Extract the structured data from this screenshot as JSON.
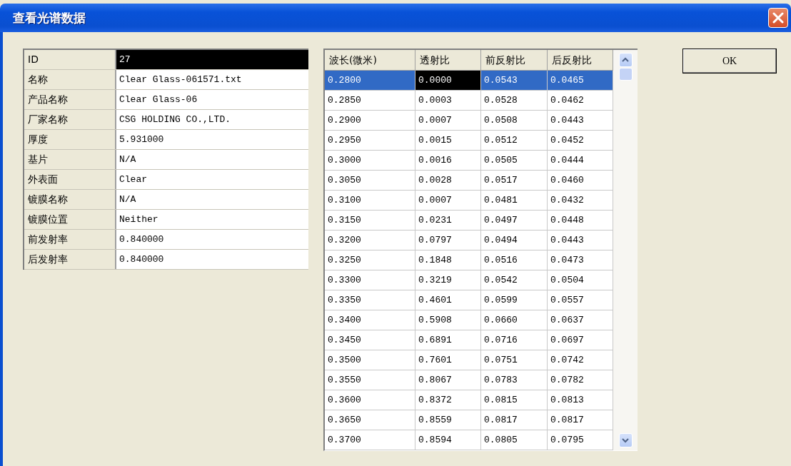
{
  "window": {
    "title": "查看光谱数据"
  },
  "properties": [
    {
      "label": "ID",
      "value": "27",
      "focused": true
    },
    {
      "label": "名称",
      "value": "Clear Glass-061571.txt",
      "focused": false
    },
    {
      "label": "产品名称",
      "value": "Clear Glass-06",
      "focused": false
    },
    {
      "label": "厂家名称",
      "value": "CSG HOLDING CO.,LTD.",
      "focused": false
    },
    {
      "label": "厚度",
      "value": "5.931000",
      "focused": false
    },
    {
      "label": "基片",
      "value": "N/A",
      "focused": false
    },
    {
      "label": "外表面",
      "value": "Clear",
      "focused": false
    },
    {
      "label": "镀膜名称",
      "value": "N/A",
      "focused": false
    },
    {
      "label": "镀膜位置",
      "value": "Neither",
      "focused": false
    },
    {
      "label": "前发射率",
      "value": "0.840000",
      "focused": false
    },
    {
      "label": "后发射率",
      "value": "0.840000",
      "focused": false
    }
  ],
  "table": {
    "columns": [
      "波长(微米)",
      "透射比",
      "前反射比",
      "后反射比"
    ],
    "rows": [
      {
        "selected": true,
        "cells": [
          {
            "text": "0.2800",
            "focused": false
          },
          {
            "text": "0.0000",
            "focused": true
          },
          {
            "text": "0.0543",
            "focused": false
          },
          {
            "text": "0.0465",
            "focused": false
          }
        ]
      },
      {
        "selected": false,
        "cells": [
          {
            "text": "0.2850",
            "focused": false
          },
          {
            "text": "0.0003",
            "focused": false
          },
          {
            "text": "0.0528",
            "focused": false
          },
          {
            "text": "0.0462",
            "focused": false
          }
        ]
      },
      {
        "selected": false,
        "cells": [
          {
            "text": "0.2900",
            "focused": false
          },
          {
            "text": "0.0007",
            "focused": false
          },
          {
            "text": "0.0508",
            "focused": false
          },
          {
            "text": "0.0443",
            "focused": false
          }
        ]
      },
      {
        "selected": false,
        "cells": [
          {
            "text": "0.2950",
            "focused": false
          },
          {
            "text": "0.0015",
            "focused": false
          },
          {
            "text": "0.0512",
            "focused": false
          },
          {
            "text": "0.0452",
            "focused": false
          }
        ]
      },
      {
        "selected": false,
        "cells": [
          {
            "text": "0.3000",
            "focused": false
          },
          {
            "text": "0.0016",
            "focused": false
          },
          {
            "text": "0.0505",
            "focused": false
          },
          {
            "text": "0.0444",
            "focused": false
          }
        ]
      },
      {
        "selected": false,
        "cells": [
          {
            "text": "0.3050",
            "focused": false
          },
          {
            "text": "0.0028",
            "focused": false
          },
          {
            "text": "0.0517",
            "focused": false
          },
          {
            "text": "0.0460",
            "focused": false
          }
        ]
      },
      {
        "selected": false,
        "cells": [
          {
            "text": "0.3100",
            "focused": false
          },
          {
            "text": "0.0007",
            "focused": false
          },
          {
            "text": "0.0481",
            "focused": false
          },
          {
            "text": "0.0432",
            "focused": false
          }
        ]
      },
      {
        "selected": false,
        "cells": [
          {
            "text": "0.3150",
            "focused": false
          },
          {
            "text": "0.0231",
            "focused": false
          },
          {
            "text": "0.0497",
            "focused": false
          },
          {
            "text": "0.0448",
            "focused": false
          }
        ]
      },
      {
        "selected": false,
        "cells": [
          {
            "text": "0.3200",
            "focused": false
          },
          {
            "text": "0.0797",
            "focused": false
          },
          {
            "text": "0.0494",
            "focused": false
          },
          {
            "text": "0.0443",
            "focused": false
          }
        ]
      },
      {
        "selected": false,
        "cells": [
          {
            "text": "0.3250",
            "focused": false
          },
          {
            "text": "0.1848",
            "focused": false
          },
          {
            "text": "0.0516",
            "focused": false
          },
          {
            "text": "0.0473",
            "focused": false
          }
        ]
      },
      {
        "selected": false,
        "cells": [
          {
            "text": "0.3300",
            "focused": false
          },
          {
            "text": "0.3219",
            "focused": false
          },
          {
            "text": "0.0542",
            "focused": false
          },
          {
            "text": "0.0504",
            "focused": false
          }
        ]
      },
      {
        "selected": false,
        "cells": [
          {
            "text": "0.3350",
            "focused": false
          },
          {
            "text": "0.4601",
            "focused": false
          },
          {
            "text": "0.0599",
            "focused": false
          },
          {
            "text": "0.0557",
            "focused": false
          }
        ]
      },
      {
        "selected": false,
        "cells": [
          {
            "text": "0.3400",
            "focused": false
          },
          {
            "text": "0.5908",
            "focused": false
          },
          {
            "text": "0.0660",
            "focused": false
          },
          {
            "text": "0.0637",
            "focused": false
          }
        ]
      },
      {
        "selected": false,
        "cells": [
          {
            "text": "0.3450",
            "focused": false
          },
          {
            "text": "0.6891",
            "focused": false
          },
          {
            "text": "0.0716",
            "focused": false
          },
          {
            "text": "0.0697",
            "focused": false
          }
        ]
      },
      {
        "selected": false,
        "cells": [
          {
            "text": "0.3500",
            "focused": false
          },
          {
            "text": "0.7601",
            "focused": false
          },
          {
            "text": "0.0751",
            "focused": false
          },
          {
            "text": "0.0742",
            "focused": false
          }
        ]
      },
      {
        "selected": false,
        "cells": [
          {
            "text": "0.3550",
            "focused": false
          },
          {
            "text": "0.8067",
            "focused": false
          },
          {
            "text": "0.0783",
            "focused": false
          },
          {
            "text": "0.0782",
            "focused": false
          }
        ]
      },
      {
        "selected": false,
        "cells": [
          {
            "text": "0.3600",
            "focused": false
          },
          {
            "text": "0.8372",
            "focused": false
          },
          {
            "text": "0.0815",
            "focused": false
          },
          {
            "text": "0.0813",
            "focused": false
          }
        ]
      },
      {
        "selected": false,
        "cells": [
          {
            "text": "0.3650",
            "focused": false
          },
          {
            "text": "0.8559",
            "focused": false
          },
          {
            "text": "0.0817",
            "focused": false
          },
          {
            "text": "0.0817",
            "focused": false
          }
        ]
      },
      {
        "selected": false,
        "cells": [
          {
            "text": "0.3700",
            "focused": false
          },
          {
            "text": "0.8594",
            "focused": false
          },
          {
            "text": "0.0805",
            "focused": false
          },
          {
            "text": "0.0795",
            "focused": false
          }
        ]
      }
    ]
  },
  "buttons": [
    "OK"
  ]
}
